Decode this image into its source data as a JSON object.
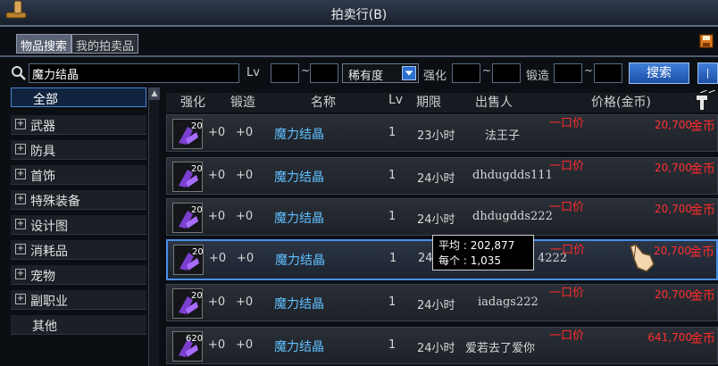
{
  "window": {
    "title": "拍卖行(B)"
  },
  "tabs": [
    {
      "label": "物品搜索",
      "active": true
    },
    {
      "label": "我的拍卖品",
      "active": false
    }
  ],
  "search": {
    "query": "魔力结晶",
    "level_label": "Lv",
    "rarity_value": "稀有度",
    "enhance_label": "强化",
    "forge_label": "锻造",
    "range_sep": "~",
    "search_button": "搜索",
    "collapse_button": "|<<"
  },
  "sidebar": {
    "categories": [
      {
        "label": "全部",
        "selected": true,
        "expandable": false
      },
      {
        "label": "武器",
        "selected": false,
        "expandable": true
      },
      {
        "label": "防具",
        "selected": false,
        "expandable": true
      },
      {
        "label": "首饰",
        "selected": false,
        "expandable": true
      },
      {
        "label": "特殊装备",
        "selected": false,
        "expandable": true
      },
      {
        "label": "设计图",
        "selected": false,
        "expandable": true
      },
      {
        "label": "消耗品",
        "selected": false,
        "expandable": true
      },
      {
        "label": "宠物",
        "selected": false,
        "expandable": true
      },
      {
        "label": "副职业",
        "selected": false,
        "expandable": true
      },
      {
        "label": "其他",
        "selected": false,
        "expandable": false
      }
    ]
  },
  "table": {
    "headers": {
      "enhance": "强化",
      "forge": "锻造",
      "name": "名称",
      "lv": "Lv",
      "duration": "期限",
      "seller": "出售人",
      "price": "价格(金币)"
    },
    "rows": [
      {
        "qty": "20",
        "enhance": "+0",
        "forge": "+0",
        "name": "魔力结晶",
        "lv": "1",
        "duration": "23小时",
        "seller": "法王子",
        "buyout": "一口价",
        "price": "20,700",
        "currency": "金币"
      },
      {
        "qty": "20",
        "enhance": "+0",
        "forge": "+0",
        "name": "魔力结晶",
        "lv": "1",
        "duration": "24小时",
        "seller": "dhdugdds111",
        "buyout": "一口价",
        "price": "20,700",
        "currency": "金币"
      },
      {
        "qty": "20",
        "enhance": "+0",
        "forge": "+0",
        "name": "魔力结晶",
        "lv": "1",
        "duration": "24小时",
        "seller": "dhdugdds222",
        "buyout": "一口价",
        "price": "20,700",
        "currency": "金币"
      },
      {
        "qty": "20",
        "enhance": "+0",
        "forge": "+0",
        "name": "魔力结晶",
        "lv": "1",
        "duration": "24",
        "seller": "4222",
        "buyout": "一口价",
        "price": "20,700",
        "currency": "金币"
      },
      {
        "qty": "20",
        "enhance": "+0",
        "forge": "+0",
        "name": "魔力结晶",
        "lv": "1",
        "duration": "24小时",
        "seller": "iadags222",
        "buyout": "一口价",
        "price": "20,700",
        "currency": "金币"
      },
      {
        "qty": "620",
        "enhance": "+0",
        "forge": "+0",
        "name": "魔力结晶",
        "lv": "1",
        "duration": "24小时",
        "seller": "爱若去了爱你",
        "buyout": "一口价",
        "price": "641,700",
        "currency": "金币"
      }
    ]
  },
  "tooltip": {
    "avg_label": "平均",
    "avg_value": ": 202,877",
    "each_label": "每个",
    "each_value": ": 1,035"
  },
  "colors": {
    "item_name": "#5fc0ff",
    "price": "#ff3030",
    "selected_border": "#4a8fe8",
    "button": "#2b6fd1"
  }
}
